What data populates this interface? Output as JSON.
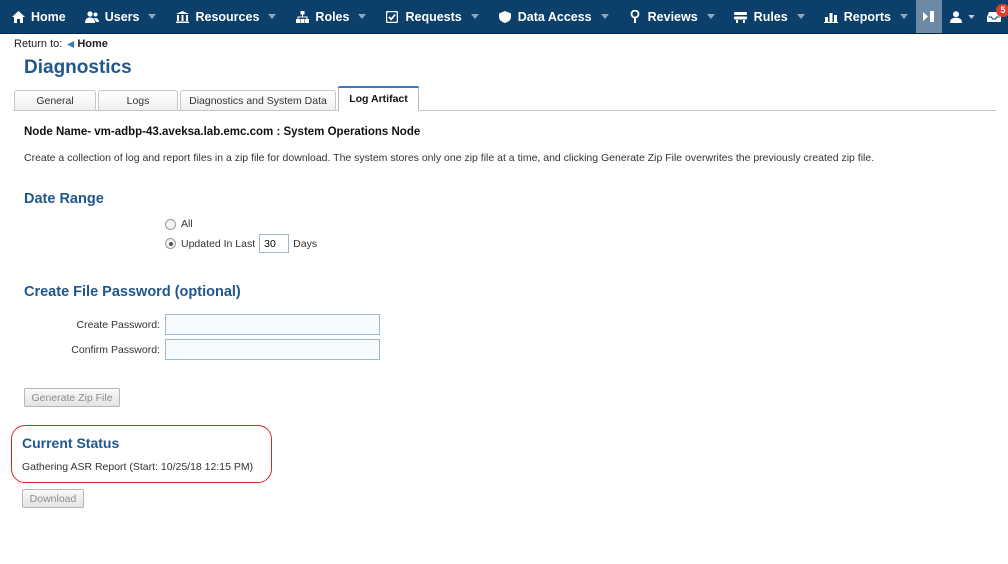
{
  "nav": {
    "items": [
      {
        "id": "home",
        "label": "Home",
        "icon": "home-icon",
        "caret": false
      },
      {
        "id": "users",
        "label": "Users",
        "icon": "users-icon",
        "caret": true
      },
      {
        "id": "resources",
        "label": "Resources",
        "icon": "resources-icon",
        "caret": true
      },
      {
        "id": "roles",
        "label": "Roles",
        "icon": "roles-icon",
        "caret": true
      },
      {
        "id": "requests",
        "label": "Requests",
        "icon": "requests-icon",
        "caret": true
      },
      {
        "id": "data-access",
        "label": "Data Access",
        "icon": "data-access-icon",
        "caret": true
      },
      {
        "id": "reviews",
        "label": "Reviews",
        "icon": "reviews-icon",
        "caret": true
      },
      {
        "id": "rules",
        "label": "Rules",
        "icon": "rules-icon",
        "caret": true
      },
      {
        "id": "reports",
        "label": "Reports",
        "icon": "reports-icon",
        "caret": true
      }
    ],
    "notification_count": "5",
    "colors": {
      "bar": "#0d3f6b",
      "badge": "#e23b2f"
    }
  },
  "breadcrumb": {
    "prefix": "Return to:",
    "home": "Home"
  },
  "page": {
    "title": "Diagnostics"
  },
  "tabs": [
    {
      "label": "General",
      "active": false
    },
    {
      "label": "Logs",
      "active": false
    },
    {
      "label": "Diagnostics and System Data",
      "active": false
    },
    {
      "label": "Log Artifact",
      "active": true
    }
  ],
  "node_name": "Node Name- vm-adbp-43.aveksa.lab.emc.com : System Operations Node",
  "description": "Create a collection of log and report files in a zip file for download. The system stores only one zip file at a time, and clicking Generate Zip File overwrites the previously created zip file.",
  "date_range": {
    "heading": "Date Range",
    "option_all": "All",
    "option_updated": "Updated In Last",
    "days_value": "30",
    "days_unit": "Days",
    "selected": "updated"
  },
  "password": {
    "heading": "Create File Password (optional)",
    "create_label": "Create Password:",
    "confirm_label": "Confirm Password:",
    "create_value": "",
    "confirm_value": ""
  },
  "buttons": {
    "generate": "Generate Zip File",
    "download": "Download"
  },
  "status": {
    "heading": "Current Status",
    "text": "Gathering ASR Report (Start: 10/25/18 12:15 PM)"
  }
}
